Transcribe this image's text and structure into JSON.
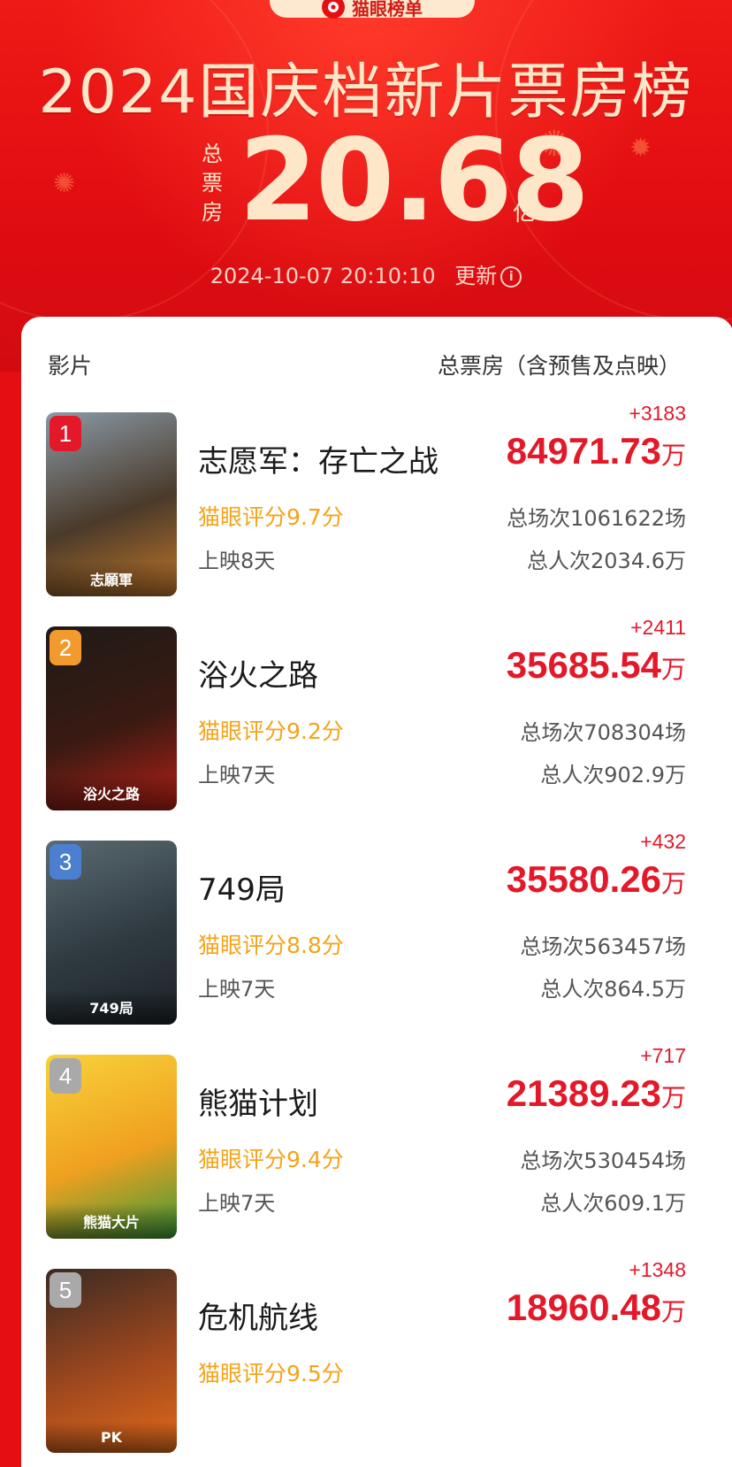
{
  "header": {
    "brand": "猫眼榜单",
    "title": "2024国庆档新片票房榜",
    "total_label": [
      "总",
      "票",
      "房"
    ],
    "total_value": "20.68",
    "total_unit": "亿",
    "update_time": "2024-10-07   20:10:10",
    "update_label": "更新",
    "colors": {
      "bg": "#e40e13",
      "gold": "#fde7c8",
      "accent": "#e3192a",
      "score": "#f5a319"
    }
  },
  "table": {
    "col_film": "影片",
    "col_box": "总票房（含预售及点映）",
    "rows": [
      {
        "rank": "1",
        "rank_color": "#e3192a",
        "poster_caption": "志願軍",
        "poster_colors": [
          "#8a9aa7",
          "#4a3a2a",
          "#c0762a"
        ],
        "title": "志愿军：存亡之战",
        "score": "猫眼评分9.7分",
        "days": "上映8天",
        "delta": "+3183",
        "box": "84971.73",
        "unit": "万",
        "shows": "总场次1061622场",
        "people": "总人次2034.6万"
      },
      {
        "rank": "2",
        "rank_color": "#f29a2e",
        "poster_caption": "浴火之路",
        "poster_colors": [
          "#1f1a18",
          "#3a1a12",
          "#b52016"
        ],
        "title": "浴火之路",
        "score": "猫眼评分9.2分",
        "days": "上映7天",
        "delta": "+2411",
        "box": "35685.54",
        "unit": "万",
        "shows": "总场次708304场",
        "people": "总人次902.9万"
      },
      {
        "rank": "3",
        "rank_color": "#4d7fd1",
        "poster_caption": "749局",
        "poster_colors": [
          "#5a6a72",
          "#2f3a40",
          "#1c2327"
        ],
        "title": "749局",
        "score": "猫眼评分8.8分",
        "days": "上映7天",
        "delta": "+432",
        "box": "35580.26",
        "unit": "万",
        "shows": "总场次563457场",
        "people": "总人次864.5万"
      },
      {
        "rank": "4",
        "rank_color": "#a9a9a9",
        "poster_caption": "熊猫大片",
        "poster_colors": [
          "#f7d23a",
          "#f0a020",
          "#3a9a3a"
        ],
        "title": "熊猫计划",
        "score": "猫眼评分9.4分",
        "days": "上映7天",
        "delta": "+717",
        "box": "21389.23",
        "unit": "万",
        "shows": "总场次530454场",
        "people": "总人次609.1万"
      },
      {
        "rank": "5",
        "rank_color": "#a9a9a9",
        "poster_caption": "PK",
        "poster_colors": [
          "#3a2a22",
          "#a0481e",
          "#e06a1a"
        ],
        "title": "危机航线",
        "score": "猫眼评分9.5分",
        "days": "",
        "delta": "+1348",
        "box": "18960.48",
        "unit": "万",
        "shows": "",
        "people": ""
      }
    ]
  }
}
